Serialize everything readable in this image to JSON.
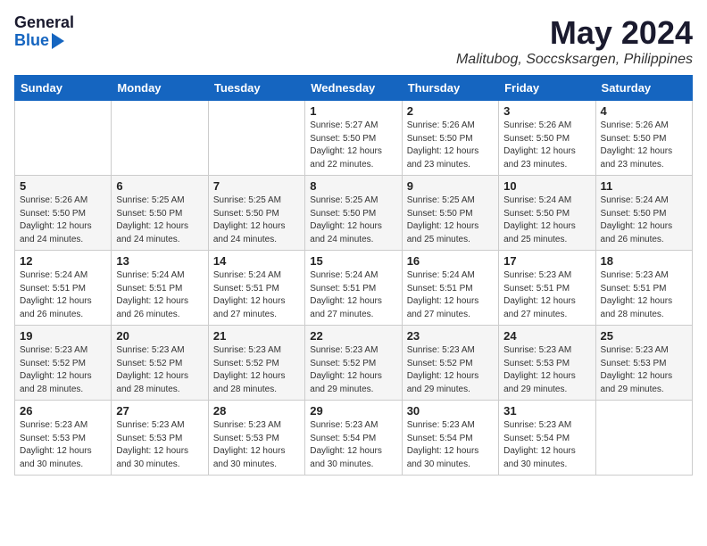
{
  "header": {
    "logo_general": "General",
    "logo_blue": "Blue",
    "month": "May 2024",
    "location": "Malitubog, Soccsksargen, Philippines"
  },
  "days_of_week": [
    "Sunday",
    "Monday",
    "Tuesday",
    "Wednesday",
    "Thursday",
    "Friday",
    "Saturday"
  ],
  "weeks": [
    [
      {
        "num": "",
        "info": ""
      },
      {
        "num": "",
        "info": ""
      },
      {
        "num": "",
        "info": ""
      },
      {
        "num": "1",
        "info": "Sunrise: 5:27 AM\nSunset: 5:50 PM\nDaylight: 12 hours\nand 22 minutes."
      },
      {
        "num": "2",
        "info": "Sunrise: 5:26 AM\nSunset: 5:50 PM\nDaylight: 12 hours\nand 23 minutes."
      },
      {
        "num": "3",
        "info": "Sunrise: 5:26 AM\nSunset: 5:50 PM\nDaylight: 12 hours\nand 23 minutes."
      },
      {
        "num": "4",
        "info": "Sunrise: 5:26 AM\nSunset: 5:50 PM\nDaylight: 12 hours\nand 23 minutes."
      }
    ],
    [
      {
        "num": "5",
        "info": "Sunrise: 5:26 AM\nSunset: 5:50 PM\nDaylight: 12 hours\nand 24 minutes."
      },
      {
        "num": "6",
        "info": "Sunrise: 5:25 AM\nSunset: 5:50 PM\nDaylight: 12 hours\nand 24 minutes."
      },
      {
        "num": "7",
        "info": "Sunrise: 5:25 AM\nSunset: 5:50 PM\nDaylight: 12 hours\nand 24 minutes."
      },
      {
        "num": "8",
        "info": "Sunrise: 5:25 AM\nSunset: 5:50 PM\nDaylight: 12 hours\nand 24 minutes."
      },
      {
        "num": "9",
        "info": "Sunrise: 5:25 AM\nSunset: 5:50 PM\nDaylight: 12 hours\nand 25 minutes."
      },
      {
        "num": "10",
        "info": "Sunrise: 5:24 AM\nSunset: 5:50 PM\nDaylight: 12 hours\nand 25 minutes."
      },
      {
        "num": "11",
        "info": "Sunrise: 5:24 AM\nSunset: 5:50 PM\nDaylight: 12 hours\nand 26 minutes."
      }
    ],
    [
      {
        "num": "12",
        "info": "Sunrise: 5:24 AM\nSunset: 5:51 PM\nDaylight: 12 hours\nand 26 minutes."
      },
      {
        "num": "13",
        "info": "Sunrise: 5:24 AM\nSunset: 5:51 PM\nDaylight: 12 hours\nand 26 minutes."
      },
      {
        "num": "14",
        "info": "Sunrise: 5:24 AM\nSunset: 5:51 PM\nDaylight: 12 hours\nand 27 minutes."
      },
      {
        "num": "15",
        "info": "Sunrise: 5:24 AM\nSunset: 5:51 PM\nDaylight: 12 hours\nand 27 minutes."
      },
      {
        "num": "16",
        "info": "Sunrise: 5:24 AM\nSunset: 5:51 PM\nDaylight: 12 hours\nand 27 minutes."
      },
      {
        "num": "17",
        "info": "Sunrise: 5:23 AM\nSunset: 5:51 PM\nDaylight: 12 hours\nand 27 minutes."
      },
      {
        "num": "18",
        "info": "Sunrise: 5:23 AM\nSunset: 5:51 PM\nDaylight: 12 hours\nand 28 minutes."
      }
    ],
    [
      {
        "num": "19",
        "info": "Sunrise: 5:23 AM\nSunset: 5:52 PM\nDaylight: 12 hours\nand 28 minutes."
      },
      {
        "num": "20",
        "info": "Sunrise: 5:23 AM\nSunset: 5:52 PM\nDaylight: 12 hours\nand 28 minutes."
      },
      {
        "num": "21",
        "info": "Sunrise: 5:23 AM\nSunset: 5:52 PM\nDaylight: 12 hours\nand 28 minutes."
      },
      {
        "num": "22",
        "info": "Sunrise: 5:23 AM\nSunset: 5:52 PM\nDaylight: 12 hours\nand 29 minutes."
      },
      {
        "num": "23",
        "info": "Sunrise: 5:23 AM\nSunset: 5:52 PM\nDaylight: 12 hours\nand 29 minutes."
      },
      {
        "num": "24",
        "info": "Sunrise: 5:23 AM\nSunset: 5:53 PM\nDaylight: 12 hours\nand 29 minutes."
      },
      {
        "num": "25",
        "info": "Sunrise: 5:23 AM\nSunset: 5:53 PM\nDaylight: 12 hours\nand 29 minutes."
      }
    ],
    [
      {
        "num": "26",
        "info": "Sunrise: 5:23 AM\nSunset: 5:53 PM\nDaylight: 12 hours\nand 30 minutes."
      },
      {
        "num": "27",
        "info": "Sunrise: 5:23 AM\nSunset: 5:53 PM\nDaylight: 12 hours\nand 30 minutes."
      },
      {
        "num": "28",
        "info": "Sunrise: 5:23 AM\nSunset: 5:53 PM\nDaylight: 12 hours\nand 30 minutes."
      },
      {
        "num": "29",
        "info": "Sunrise: 5:23 AM\nSunset: 5:54 PM\nDaylight: 12 hours\nand 30 minutes."
      },
      {
        "num": "30",
        "info": "Sunrise: 5:23 AM\nSunset: 5:54 PM\nDaylight: 12 hours\nand 30 minutes."
      },
      {
        "num": "31",
        "info": "Sunrise: 5:23 AM\nSunset: 5:54 PM\nDaylight: 12 hours\nand 30 minutes."
      },
      {
        "num": "",
        "info": ""
      }
    ]
  ]
}
